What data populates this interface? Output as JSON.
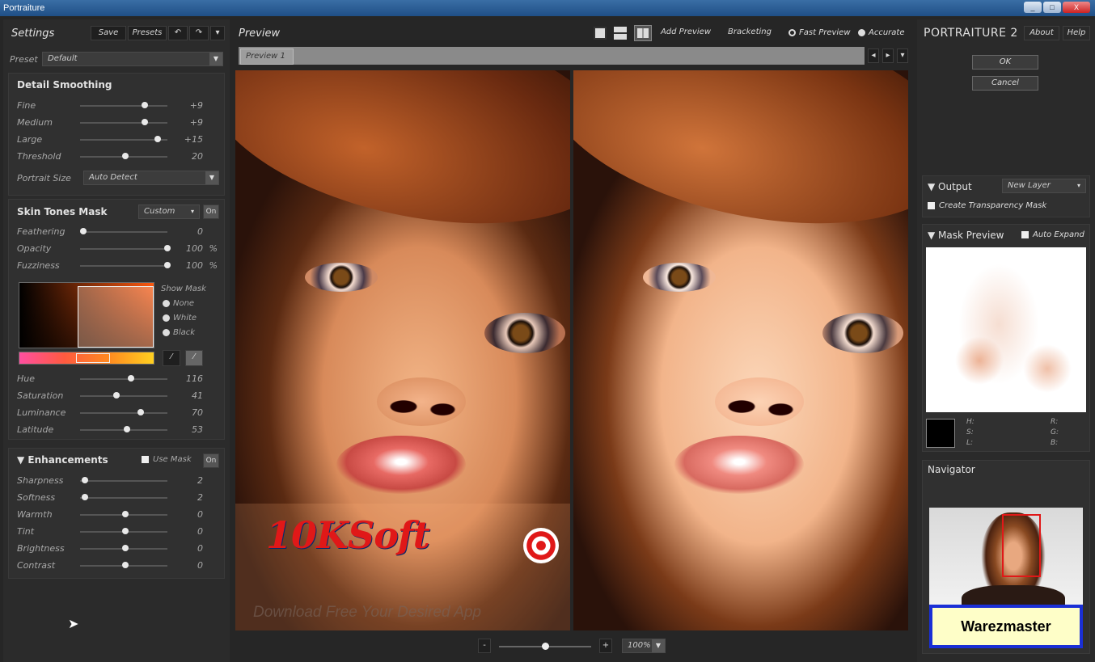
{
  "window": {
    "title": "Portraiture",
    "controls": [
      "_",
      "□",
      "X"
    ]
  },
  "settings": {
    "title": "Settings",
    "save": "Save",
    "presets": "Presets",
    "undo": "↶",
    "redo": "↷",
    "menu": "▾",
    "preset_label": "Preset",
    "preset_value": "Default"
  },
  "detail_smoothing": {
    "title": "Detail Smoothing",
    "sliders": [
      {
        "label": "Fine",
        "value": "+9",
        "level": 0.73
      },
      {
        "label": "Medium",
        "value": "+9",
        "level": 0.73
      },
      {
        "label": "Large",
        "value": "+15",
        "level": 0.88
      },
      {
        "label": "Threshold",
        "value": "20",
        "level": 0.5
      }
    ],
    "portrait_size_label": "Portrait Size",
    "portrait_size_value": "Auto Detect"
  },
  "skin_tones": {
    "title": "Skin Tones Mask",
    "mode": "Custom",
    "toggle": "On",
    "sliders_top": [
      {
        "label": "Feathering",
        "value": "0",
        "unit": "",
        "level": 0.0
      },
      {
        "label": "Opacity",
        "value": "100",
        "unit": "%",
        "level": 1.0
      },
      {
        "label": "Fuzziness",
        "value": "100",
        "unit": "%",
        "level": 1.0
      }
    ],
    "show_mask_label": "Show Mask",
    "show_mask_options": [
      "None",
      "White",
      "Black"
    ],
    "sliders_bottom": [
      {
        "label": "Hue",
        "value": "116",
        "unit": "",
        "level": 0.57
      },
      {
        "label": "Saturation",
        "value": "41",
        "unit": "",
        "level": 0.39
      },
      {
        "label": "Luminance",
        "value": "70",
        "unit": "",
        "level": 0.68
      },
      {
        "label": "Latitude",
        "value": "53",
        "unit": "",
        "level": 0.52
      }
    ]
  },
  "enhancements": {
    "title": "Enhancements",
    "use_mask": "Use Mask",
    "toggle": "On",
    "sliders": [
      {
        "label": "Sharpness",
        "value": "2",
        "level": 0.02
      },
      {
        "label": "Softness",
        "value": "2",
        "level": 0.02
      },
      {
        "label": "Warmth",
        "value": "0",
        "level": 0.5
      },
      {
        "label": "Tint",
        "value": "0",
        "level": 0.5
      },
      {
        "label": "Brightness",
        "value": "0",
        "level": 0.5
      },
      {
        "label": "Contrast",
        "value": "0",
        "level": 0.5
      }
    ]
  },
  "preview": {
    "title": "Preview",
    "add_preview": "Add Preview",
    "bracketing": "Bracketing",
    "fast_preview": "Fast Preview",
    "accurate": "Accurate",
    "tab": "Preview 1",
    "zoom": "100%",
    "zoom_minus": "-",
    "zoom_plus": "+",
    "zoom_level": 0.5,
    "watermark_brand": "10KSoft",
    "watermark_caption": "Download Free Your Desired App"
  },
  "right": {
    "brand": "PORTRAITURE 2",
    "about": "About",
    "help": "Help",
    "ok": "OK",
    "cancel": "Cancel",
    "output_title": "Output",
    "output_value": "New Layer",
    "create_mask": "Create Transparency Mask",
    "mask_preview_title": "Mask Preview",
    "auto_expand": "Auto Expand",
    "hsl_labels": [
      "H:",
      "S:",
      "L:"
    ],
    "rgb_labels": [
      "R:",
      "G:",
      "B:"
    ],
    "navigator_title": "Navigator",
    "badge": "Warezmaster"
  },
  "colors": {
    "accent_zoom_box": "#e01818",
    "badge_bg": "#fefec8",
    "badge_border": "#1a2fd6"
  }
}
